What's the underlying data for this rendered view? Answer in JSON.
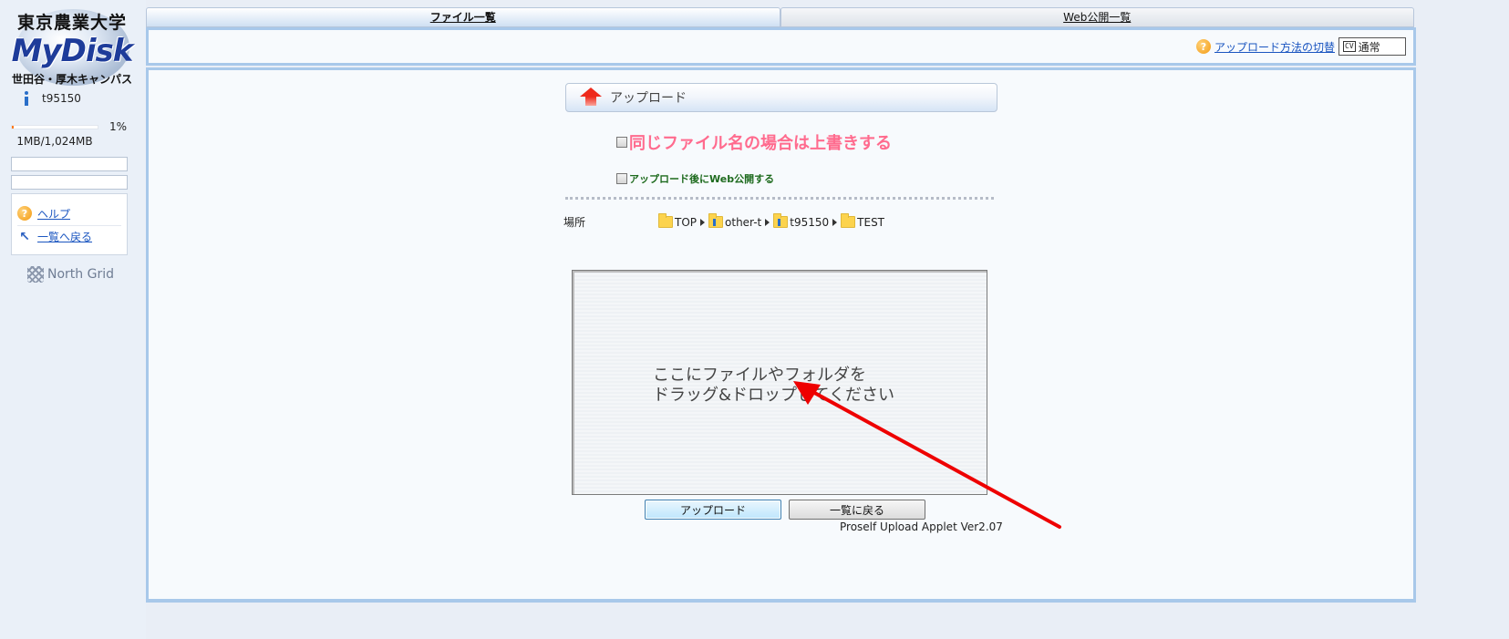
{
  "sidebar": {
    "logo": {
      "university": "東京農業大学",
      "brand": "MyDisk",
      "campus": "世田谷・厚木キャンパス"
    },
    "user_name": "t95150",
    "quota": {
      "percent_label": "1%",
      "usage_text": "1MB/1,024MB",
      "fraction": 0.01
    },
    "menu": [
      {
        "label": "ヘルプ",
        "icon": "help-icon"
      },
      {
        "label": "一覧へ戻る",
        "icon": "back-arrow-icon"
      }
    ],
    "footer_logo": "North Grid"
  },
  "tabs": [
    {
      "label": "ファイル一覧",
      "active": true
    },
    {
      "label": "Web公開一覧",
      "active": false
    }
  ],
  "toolbar": {
    "switch_link": "アップロード方法の切替",
    "mode_value": "通常",
    "mode_icon_text": "CV"
  },
  "upload": {
    "title": "アップロード",
    "overwrite_label": "同じファイル名の場合は上書きする",
    "web_publish_label": "アップロード後にWeb公開する",
    "location_label": "場所",
    "breadcrumb": [
      "TOP",
      "other-t",
      "t95150",
      "TEST"
    ],
    "drop_text_line1": "ここにファイルやフォルダを",
    "drop_text_line2": "ドラッグ&ドロップしてください",
    "upload_button": "アップロード",
    "back_button": "一覧に戻る",
    "applet_version": "Proself Upload Applet Ver2.07"
  },
  "colors": {
    "accent_pink": "#ff6b8e",
    "accent_green": "#1d6a1d",
    "frame_blue": "#a8c8ea",
    "annotation_red": "#ee0000"
  }
}
